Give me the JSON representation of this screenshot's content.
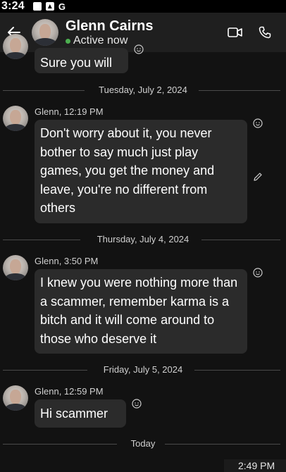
{
  "status_bar": {
    "time": "3:24",
    "icons": [
      "notification-square-icon",
      "photo-icon",
      "google-icon"
    ],
    "g_letter": "G"
  },
  "header": {
    "contact_name": "Glenn Cairns",
    "presence": "Active now",
    "presence_color": "#4caf50",
    "icons": [
      "back-arrow-icon",
      "video-call-icon",
      "phone-call-icon"
    ]
  },
  "messages": [
    {
      "sender_time": "",
      "text": "Sure you will"
    },
    {
      "sender_time": "Glenn, 12:19 PM",
      "text": "Don't worry about it, you never bother to say much just play games, you get the money and leave, you're no different from others"
    },
    {
      "sender_time": "Glenn, 3:50 PM",
      "text": "I knew you were nothing more than a scammer, remember karma is a bitch and it will come around to those who deserve it"
    },
    {
      "sender_time": "Glenn, 12:59 PM",
      "text": "Hi scammer"
    }
  ],
  "dividers": [
    "Tuesday, July 2, 2024",
    "Thursday, July 4, 2024",
    "Friday, July 5, 2024",
    "Today"
  ],
  "footer": {
    "time": "2:49 PM"
  },
  "colors": {
    "background": "#121212",
    "header": "#1f1f1f",
    "bubble": "#2b2b2b"
  }
}
